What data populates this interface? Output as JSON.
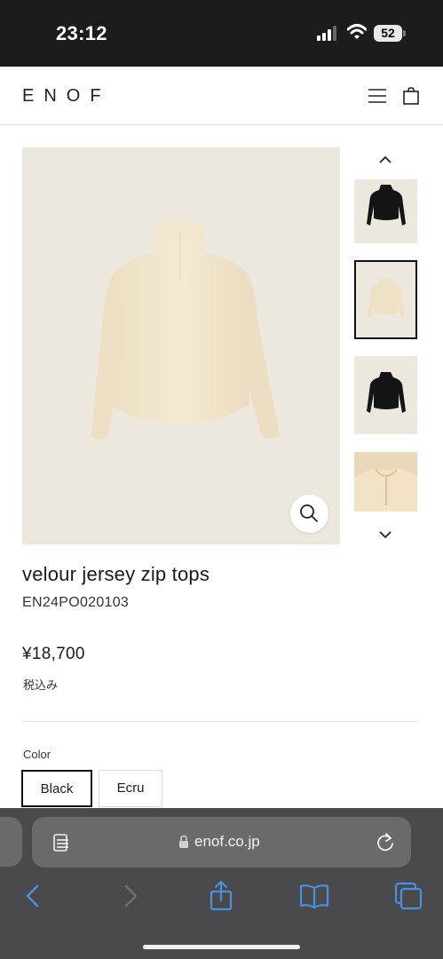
{
  "status_bar": {
    "time": "23:12",
    "battery_level": "52",
    "signal_bars_active": 3,
    "signal_bars_total": 4
  },
  "header": {
    "logo": "ENOF"
  },
  "product": {
    "name": "velour jersey zip tops",
    "code": "EN24PO020103",
    "price": "¥18,700",
    "tax_note": "税込み",
    "image_background": "#ece8dd",
    "garment_color": "#f0e4cc"
  },
  "color_selector": {
    "label": "Color",
    "options": [
      {
        "label": "Black",
        "selected": true
      },
      {
        "label": "Ecru",
        "selected": false
      }
    ]
  },
  "thumbnails": [
    {
      "icon": "black-top-thumbnail",
      "selected": false
    },
    {
      "icon": "ecru-top-thumbnail",
      "selected": true
    },
    {
      "icon": "black-top-thumbnail",
      "selected": false
    },
    {
      "icon": "ecru-detail-thumbnail",
      "selected": false
    }
  ],
  "browser": {
    "url": "enof.co.jp",
    "bar_color": "#4a4a4c",
    "accent_color": "#4a90e2"
  }
}
